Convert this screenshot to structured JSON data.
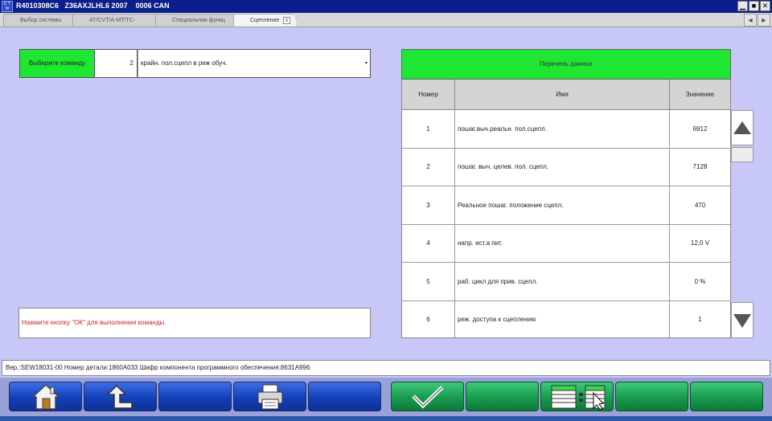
{
  "titlebar": {
    "title": "R4010308C6   Z36AXJLHL6 2007    0006 CAN",
    "logo_text": "E T W",
    "buttons": [
      "minimize-icon",
      "maximize-icon",
      "close-icon"
    ]
  },
  "tabs": [
    {
      "label": "Выбор системы"
    },
    {
      "label": "AT/CVT/A-MT/TC-SST"
    },
    {
      "label": "Специальная функц"
    },
    {
      "label": "Сцепление",
      "close": "x"
    }
  ],
  "tabnav": {
    "prev": "◄",
    "next": "►"
  },
  "command": {
    "label": "Выберите команду",
    "number": "2",
    "selected": "крайн. пол.сцепл в реж обуч.",
    "arrow": "▾"
  },
  "message": "Нажмите кнопку \"ОК\" для выполнения команды.",
  "data_list": {
    "title": "Перечень данных",
    "columns": [
      "Номер",
      "Имя",
      "Значение"
    ],
    "rows": [
      {
        "num": "1",
        "name": "пошаг.выч.реальн. пол.сцепл.",
        "value": "6912"
      },
      {
        "num": "2",
        "name": "пошаг. выч. целев. пол. сцепл.",
        "value": "7128"
      },
      {
        "num": "3",
        "name": "Реальное пошаг. положение сцепл.",
        "value": "470"
      },
      {
        "num": "4",
        "name": "напр. ист.а пит.",
        "value": "12,0 V"
      },
      {
        "num": "5",
        "name": "раб. цикл для прив. сцепл.",
        "value": "0 %"
      },
      {
        "num": "6",
        "name": "реж. доступа к сцеплению",
        "value": "1"
      }
    ]
  },
  "status": "Вер.:SEW18031-00 Номер детали:1860A033   Шифр компонента программного обеспечения:8631A996",
  "toolbar": {
    "buttons": [
      {
        "icon": "home-icon"
      },
      {
        "icon": "back-arrow-icon"
      },
      {
        "icon": ""
      },
      {
        "icon": "printer-icon"
      },
      {
        "icon": ""
      },
      {
        "icon": "checkmark-icon"
      },
      {
        "icon": ""
      },
      {
        "icon": "data-list-select-icon"
      },
      {
        "icon": ""
      },
      {
        "icon": ""
      }
    ],
    "colors": {
      "blue": "#1340b8",
      "green": "#179a4e"
    }
  },
  "colors": {
    "background": "#c8c8f8",
    "header_green": "#1ee632",
    "message_red": "#d42020",
    "titlebar": "#0a1e8c"
  }
}
